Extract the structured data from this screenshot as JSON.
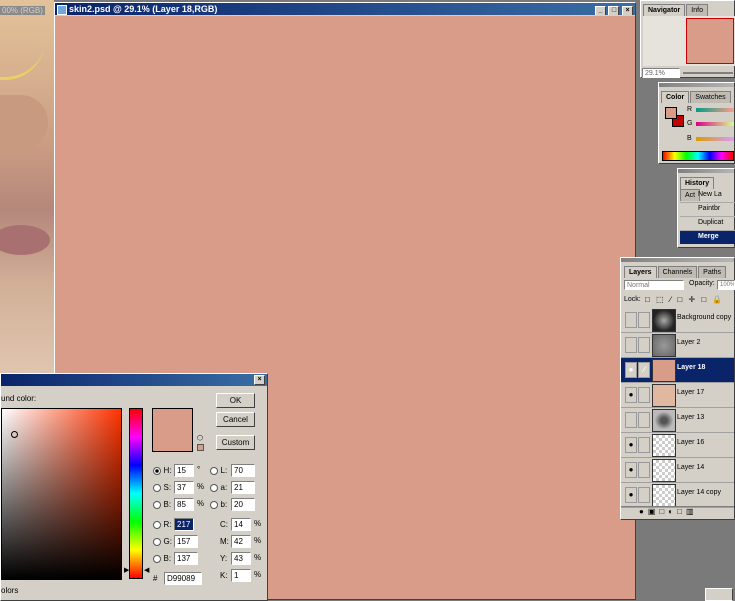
{
  "background_doc": {
    "title": "00% (RGB)"
  },
  "document": {
    "title": "skin2.psd @ 29.1% (Layer 18,RGB)",
    "canvas_color": "#D99C89",
    "controls": [
      "_",
      "□",
      "×"
    ]
  },
  "navigator": {
    "tabs": [
      "Navigator",
      "Info"
    ],
    "zoom": "29.1%"
  },
  "color_panel": {
    "tabs": [
      "Color",
      "Swatches"
    ],
    "channels": [
      "R",
      "G",
      "B"
    ]
  },
  "history": {
    "tabs": [
      "History",
      "Act"
    ],
    "items": [
      "New La",
      "Paintbr",
      "Duplicat",
      "Merge"
    ]
  },
  "layers": {
    "tabs": [
      "Layers",
      "Channels",
      "Paths"
    ],
    "blend_mode": "Normal",
    "opacity_label": "Opacity:",
    "opacity_value": "100%",
    "lock_label": "Lock:",
    "items": [
      {
        "name": "Background copy",
        "visible": false,
        "selected": false
      },
      {
        "name": "Layer 2",
        "visible": false,
        "selected": false
      },
      {
        "name": "Layer 18",
        "visible": true,
        "selected": true
      },
      {
        "name": "Layer 17",
        "visible": true,
        "selected": false
      },
      {
        "name": "Layer 13",
        "visible": false,
        "selected": false
      },
      {
        "name": "Layer 16",
        "visible": true,
        "selected": false
      },
      {
        "name": "Layer 14",
        "visible": true,
        "selected": false
      },
      {
        "name": "Layer 14 copy",
        "visible": true,
        "selected": false
      }
    ]
  },
  "color_picker": {
    "label": "und color:",
    "ok_label": "OK",
    "cancel_label": "Cancel",
    "custom_label": "Custom",
    "only_web_colors": "olors",
    "hsb": {
      "h": "15",
      "s": "37",
      "b": "85",
      "h_unit": "°",
      "s_unit": "%",
      "b_unit": "%"
    },
    "lab": {
      "l": "70",
      "a": "21",
      "b": "20"
    },
    "rgb": {
      "r": "217",
      "g": "157",
      "b": "137"
    },
    "cmyk": {
      "c": "14",
      "m": "42",
      "y": "43",
      "k": "1",
      "unit": "%"
    },
    "hex_label": "#",
    "hex": "D99089"
  }
}
